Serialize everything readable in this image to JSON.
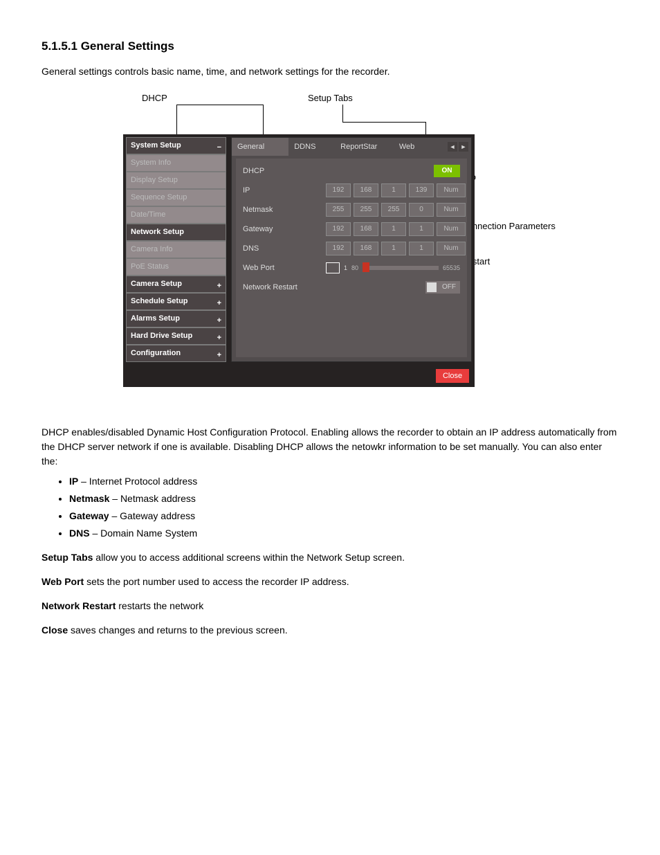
{
  "page_title": "5.1.5.1 General Settings",
  "intro": "General settings controls basic name, time, and network settings for the recorder.",
  "callouts": {
    "dhcp": "DHCP",
    "setup_tabs": "Setup Tabs",
    "network_info": "Network Info",
    "network_connection": "Network Connection Parameters",
    "close": "Close"
  },
  "ui": {
    "sidebar": {
      "heading": "System Setup",
      "heading_icon": "−",
      "items": [
        "System Info",
        "Display Setup",
        "Sequence Setup",
        "Date/Time",
        "Network Setup",
        "Camera Info",
        "PoE Status"
      ],
      "active_index": 4,
      "groups": [
        "Camera Setup",
        "Schedule Setup",
        "Alarms Setup",
        "Hard Drive Setup",
        "Configuration"
      ],
      "group_icon": "+"
    },
    "tabs": {
      "items": [
        "General Settings",
        "DDNS Setup",
        "ReportStar Setup",
        "Web Connect S"
      ],
      "active_index": 0,
      "scroll_left": "◄",
      "scroll_right": "►"
    },
    "rows": {
      "dhcp_label": "DHCP",
      "dhcp_value": "ON",
      "ip_label": "IP",
      "ip_oct": [
        "192",
        "168",
        "1",
        "139",
        "Num"
      ],
      "netmask_label": "Netmask",
      "netmask_oct": [
        "255",
        "255",
        "255",
        "0",
        "Num"
      ],
      "gateway_label": "Gateway",
      "gateway_oct": [
        "192",
        "168",
        "1",
        "1",
        "Num"
      ],
      "dns_label": "DNS",
      "dns_oct": [
        "192",
        "168",
        "1",
        "1",
        "Num"
      ],
      "webport_label": "Web Port",
      "webport_value": "1",
      "webport_min": "80",
      "webport_max": "65535",
      "restart_label": "Network Restart",
      "restart_value": "OFF"
    },
    "close": "Close"
  },
  "doc": {
    "dhcp_lead": "DHCP enables/disabled Dynamic Host Configuration Protocol. Enabling allows the recorder to obtain an IP address automatically from the DHCP server network if one is available. Disabling DHCP allows the netowkr information to be set manually. You can also enter the:",
    "dhcp_items": [
      {
        "term": "IP",
        "text": " – Internet Protocol address"
      },
      {
        "term": "Netmask",
        "text": " – Netmask address"
      },
      {
        "term": "Gateway",
        "text": " – Gateway address"
      },
      {
        "term": "DNS",
        "text": " – Domain Name System"
      }
    ],
    "setup_tabs": {
      "term": "Setup Tabs",
      "text": " allow you to access additional screens within the Network Setup screen."
    },
    "web_port": {
      "term": "Web Port",
      "text": " sets the port number used to access the recorder IP address."
    },
    "restart": {
      "term": "Network Restart",
      "text": " restarts the network"
    },
    "close": {
      "term": "Close",
      "text": " saves changes and returns to the previous screen."
    }
  }
}
